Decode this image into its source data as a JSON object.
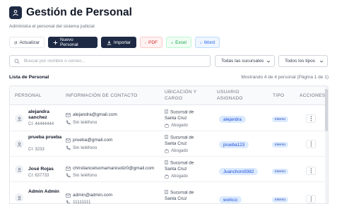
{
  "header": {
    "title": "Gestión de Personal",
    "subtitle": "Administra el personal del sistema judicial"
  },
  "toolbar": {
    "refresh": "Actualizar",
    "new": "Nuevo Personal",
    "import": "Importar",
    "pdf": "PDF",
    "excel": "Excel",
    "word": "Word"
  },
  "filters": {
    "search_placeholder": "Buscar por nombre o correo...",
    "branches": "Todas las sucursales",
    "types": "Todos los tipos"
  },
  "list": {
    "title": "Lista de Personal",
    "count": "Mostrando 4 de 4 personal (Página 1 de 1)"
  },
  "table": {
    "headers": {
      "personal": "PERSONAL",
      "contact": "INFORMACIÓN DE CONTACTO",
      "location": "UBICACIÓN Y CARGO",
      "user": "USUARIO ASIGNADO",
      "type": "TIPO",
      "actions": "ACCIONES"
    },
    "rows": [
      {
        "name": "alejandra sanchez",
        "ci": "CI: 44444444",
        "email": "alejandra@gmail.com",
        "phone": "Sin teléfono",
        "location": "Sucursal de Santa Cruz",
        "role": "Abogado",
        "user": "alejandra",
        "type": "Interno"
      },
      {
        "name": "prueba prueba",
        "ci": "CI: 3233",
        "email": "prueba@gmail.com",
        "phone": "Sin teléfono",
        "location": "Sucursal de Santa Cruz",
        "role": "Abogado",
        "user": "prueba123",
        "type": "Interno"
      },
      {
        "name": "José Rojas",
        "ci": "CI: 637733",
        "email": "christiancelsomamanisoliz0@gmail.com",
        "phone": "Sin teléfono",
        "location": "Sucursal de Santa Cruz",
        "role": "Abogado",
        "user": "Juanchoro9382",
        "type": "Interno"
      },
      {
        "name": "Admin Admin",
        "ci": "",
        "email": "admin@admin.com",
        "phone": "11111111",
        "location": "Sucursal de Santa Cruz",
        "role": "",
        "user": "workco",
        "type": "Interno"
      }
    ]
  },
  "icons": {
    "logo": "user-icon",
    "refresh": "refresh-icon",
    "new": "plus-icon",
    "import": "download-icon",
    "export": "download-icon",
    "search": "search-icon",
    "email": "mail-icon",
    "phone": "phone-icon",
    "location": "building-icon",
    "role": "briefcase-icon",
    "actions": "more-vertical-icon"
  },
  "colors": {
    "primary": "#1e2a44",
    "pdf": "#dc2626",
    "excel": "#16a34a",
    "word": "#2563eb",
    "badge": "#dbeafe"
  }
}
